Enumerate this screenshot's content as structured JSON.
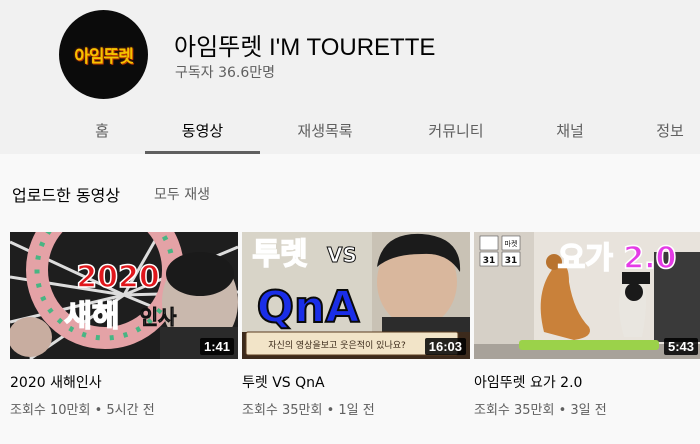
{
  "channel": {
    "avatar_text": "아임뚜렛",
    "name": "아임뚜렛 I'M TOURETTE",
    "subscribers": "구독자 36.6만명"
  },
  "tabs": [
    {
      "label": "홈"
    },
    {
      "label": "동영상"
    },
    {
      "label": "재생목록"
    },
    {
      "label": "커뮤니티"
    },
    {
      "label": "채널"
    },
    {
      "label": "정보"
    }
  ],
  "section": {
    "title": "업로드한 동영상",
    "play_all": "모두 재생"
  },
  "videos": [
    {
      "title": "2020 새해인사",
      "meta": "조회수 10만회 • 5시간 전",
      "duration": "1:41",
      "thumb_text_1": "2020",
      "thumb_text_2": "새해",
      "thumb_text_3": "인사"
    },
    {
      "title": "투렛 VS QnA",
      "meta": "조회수 35만회 • 1일 전",
      "duration": "16:03",
      "thumb_text_1": "투렛",
      "thumb_text_2": "VS",
      "thumb_text_3": "QnA",
      "thumb_caption": "자신의 영상을보고 웃은적이 있나요?"
    },
    {
      "title": "아임뚜렛 요가 2.0",
      "meta": "조회수 35만회 • 3일 전",
      "duration": "5:43",
      "thumb_text_1": "요가 2.0",
      "thumb_badge": "마켓",
      "thumb_num_1": "31",
      "thumb_num_2": "31"
    }
  ]
}
